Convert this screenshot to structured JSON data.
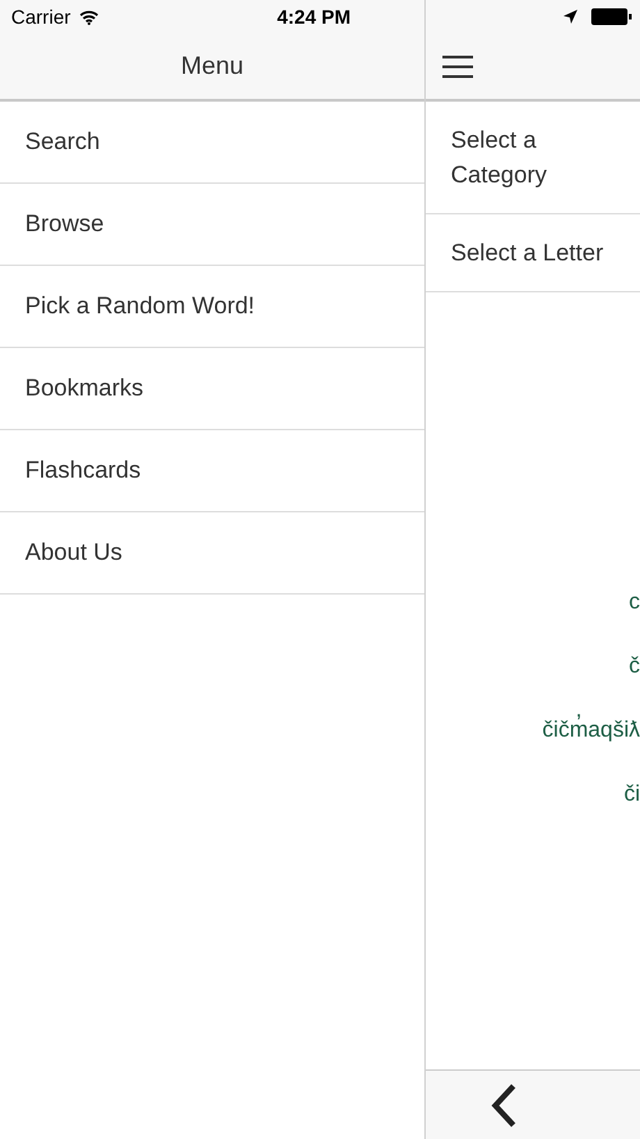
{
  "status_bar": {
    "carrier": "Carrier",
    "time": "4:24 PM"
  },
  "menu": {
    "title": "Menu",
    "items": [
      {
        "label": "Search"
      },
      {
        "label": "Browse"
      },
      {
        "label": "Pick a Random Word!"
      },
      {
        "label": "Bookmarks"
      },
      {
        "label": "Flashcards"
      },
      {
        "label": "About Us"
      }
    ]
  },
  "content": {
    "options": [
      {
        "label": "Select a Category"
      },
      {
        "label": "Select a Letter"
      }
    ],
    "words": [
      {
        "text": "c"
      },
      {
        "text": "č"
      },
      {
        "text": "čičm̓aqšiƛ"
      },
      {
        "text": "či"
      }
    ]
  }
}
